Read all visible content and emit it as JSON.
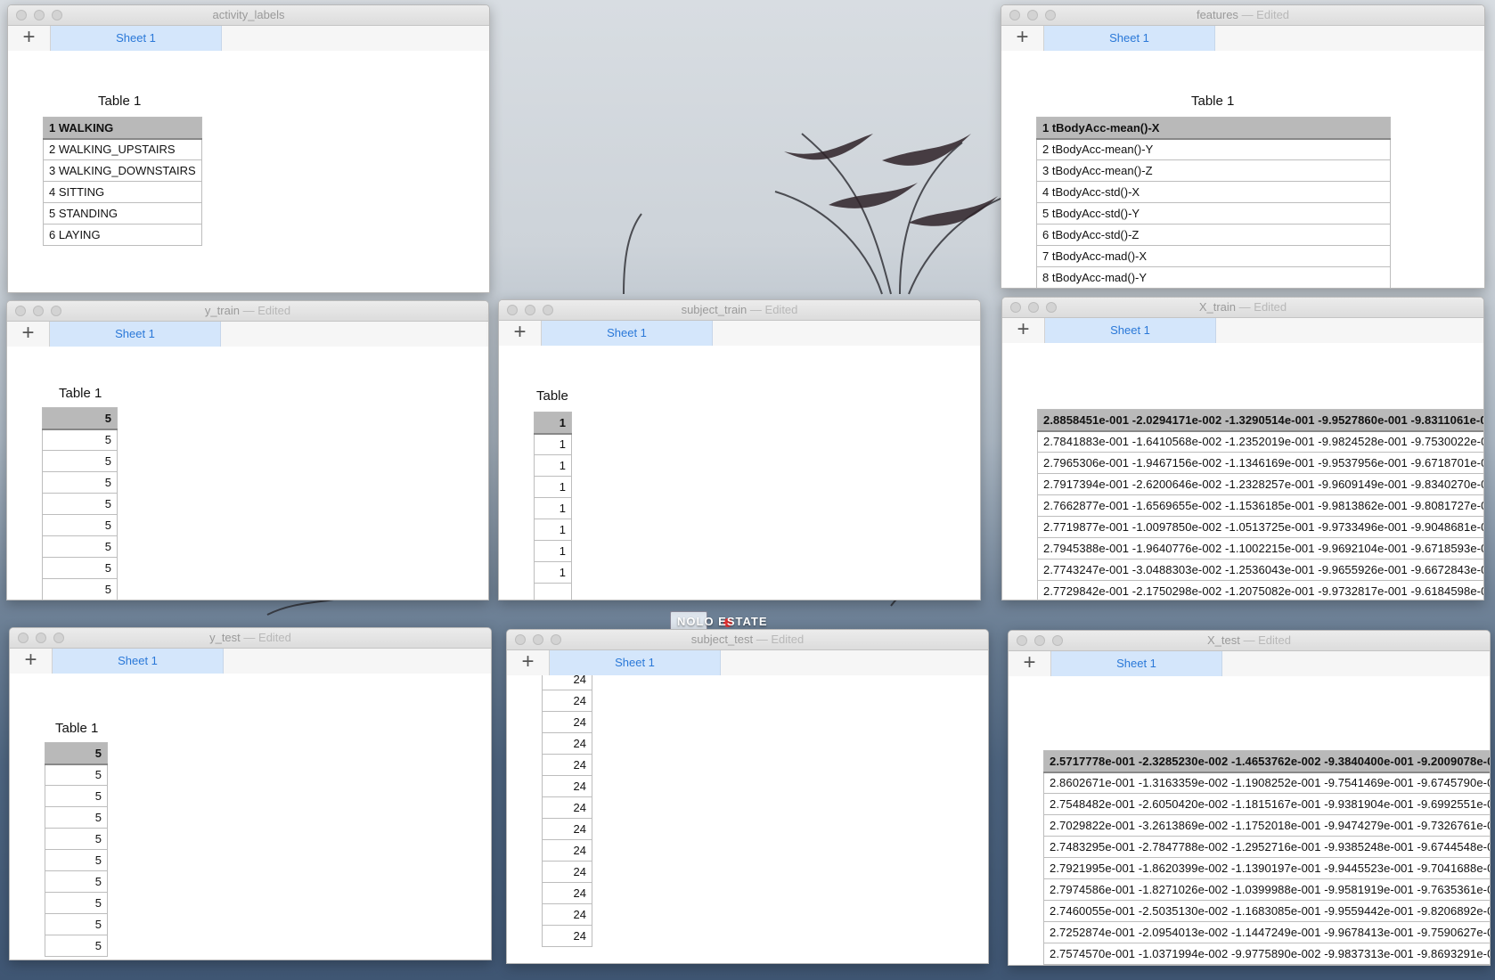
{
  "desktop": {
    "center_label": "NOLO ESTATE"
  },
  "windows": {
    "activity_labels": {
      "title": "activity_labels",
      "edited": "",
      "sheet_tab": "Sheet 1",
      "table_title": "Table 1",
      "rows": [
        "1 WALKING",
        "2 WALKING_UPSTAIRS",
        "3 WALKING_DOWNSTAIRS",
        "4 SITTING",
        "5 STANDING",
        "6 LAYING"
      ]
    },
    "features": {
      "title": "features",
      "edited": "— Edited",
      "sheet_tab": "Sheet 1",
      "table_title": "Table 1",
      "rows": [
        "1 tBodyAcc-mean()-X",
        "2 tBodyAcc-mean()-Y",
        "3 tBodyAcc-mean()-Z",
        "4 tBodyAcc-std()-X",
        "5 tBodyAcc-std()-Y",
        "6 tBodyAcc-std()-Z",
        "7 tBodyAcc-mad()-X",
        "8 tBodyAcc-mad()-Y"
      ]
    },
    "y_train": {
      "title": "y_train",
      "edited": "— Edited",
      "sheet_tab": "Sheet 1",
      "table_title": "Table 1",
      "rows": [
        "5",
        "5",
        "5",
        "5",
        "5",
        "5",
        "5",
        "5",
        "5"
      ]
    },
    "subject_train": {
      "title": "subject_train",
      "edited": "— Edited",
      "sheet_tab": "Sheet 1",
      "table_title": "Table",
      "rows": [
        "1",
        "1",
        "1",
        "1",
        "1",
        "1",
        "1",
        "1",
        ""
      ]
    },
    "X_train": {
      "title": "X_train",
      "edited": "— Edited",
      "sheet_tab": "Sheet 1",
      "rows": [
        "2.8858451e-001 -2.0294171e-002 -1.3290514e-001 -9.9527860e-001 -9.8311061e-001 -9",
        "2.7841883e-001 -1.6410568e-002 -1.2352019e-001 -9.9824528e-001 -9.7530022e-001 -9",
        "2.7965306e-001 -1.9467156e-002 -1.1346169e-001 -9.9537956e-001 -9.6718701e-001 -9",
        "2.7917394e-001 -2.6200646e-002 -1.2328257e-001 -9.9609149e-001 -9.8340270e-001 -9",
        "2.7662877e-001 -1.6569655e-002 -1.1536185e-001 -9.9813862e-001 -9.8081727e-001 -9",
        "2.7719877e-001 -1.0097850e-002 -1.0513725e-001 -9.9733496e-001 -9.9048681e-001 -9",
        "2.7945388e-001 -1.9640776e-002 -1.1002215e-001 -9.9692104e-001 -9.6718593e-001 -9",
        "2.7743247e-001 -3.0488303e-002 -1.2536043e-001 -9.9655926e-001 -9.6672843e-001 -9",
        "2.7729842e-001 -2.1750298e-002 -1.2075082e-001 -9.9732817e-001 -9.6184598e-001 -9"
      ]
    },
    "y_test": {
      "title": "y_test",
      "edited": "— Edited",
      "sheet_tab": "Sheet 1",
      "table_title": "Table 1",
      "rows": [
        "5",
        "5",
        "5",
        "5",
        "5",
        "5",
        "5",
        "5",
        "5",
        "5"
      ]
    },
    "subject_test": {
      "title": "subject_test",
      "edited": "— Edited",
      "sheet_tab": "Sheet 1",
      "rows": [
        "24",
        "24",
        "24",
        "24",
        "24",
        "24",
        "24",
        "24",
        "24",
        "24",
        "24",
        "24",
        "24"
      ]
    },
    "X_test": {
      "title": "X_test",
      "edited": "— Edited",
      "sheet_tab": "Sheet 1",
      "rows": [
        "2.5717778e-001 -2.3285230e-002 -1.4653762e-002 -9.3840400e-001 -9.2009078e-001 -6",
        "2.8602671e-001 -1.3163359e-002 -1.1908252e-001 -9.7541469e-001 -9.6745790e-001 -9",
        "2.7548482e-001 -2.6050420e-002 -1.1815167e-001 -9.9381904e-001 -9.6992551e-001 -9",
        "2.7029822e-001 -3.2613869e-002 -1.1752018e-001 -9.9474279e-001 -9.7326761e-001 -9",
        "2.7483295e-001 -2.7847788e-002 -1.2952716e-001 -9.9385248e-001 -9.6744548e-001 -9",
        "2.7921995e-001 -1.8620399e-002 -1.1390197e-001 -9.9445523e-001 -9.7041688e-001 -9",
        "2.7974586e-001 -1.8271026e-002 -1.0399988e-001 -9.9581919e-001 -9.7635361e-001 -9",
        "2.7460055e-001 -2.5035130e-002 -1.1683085e-001 -9.9559442e-001 -9.8206892e-001 -9",
        "2.7252874e-001 -2.0954013e-002 -1.1447249e-001 -9.9678413e-001 -9.7590627e-001 -9",
        "2.7574570e-001 -1.0371994e-002 -9.9775890e-002 -9.9837313e-001 -9.8693291e-001 -9"
      ]
    }
  }
}
